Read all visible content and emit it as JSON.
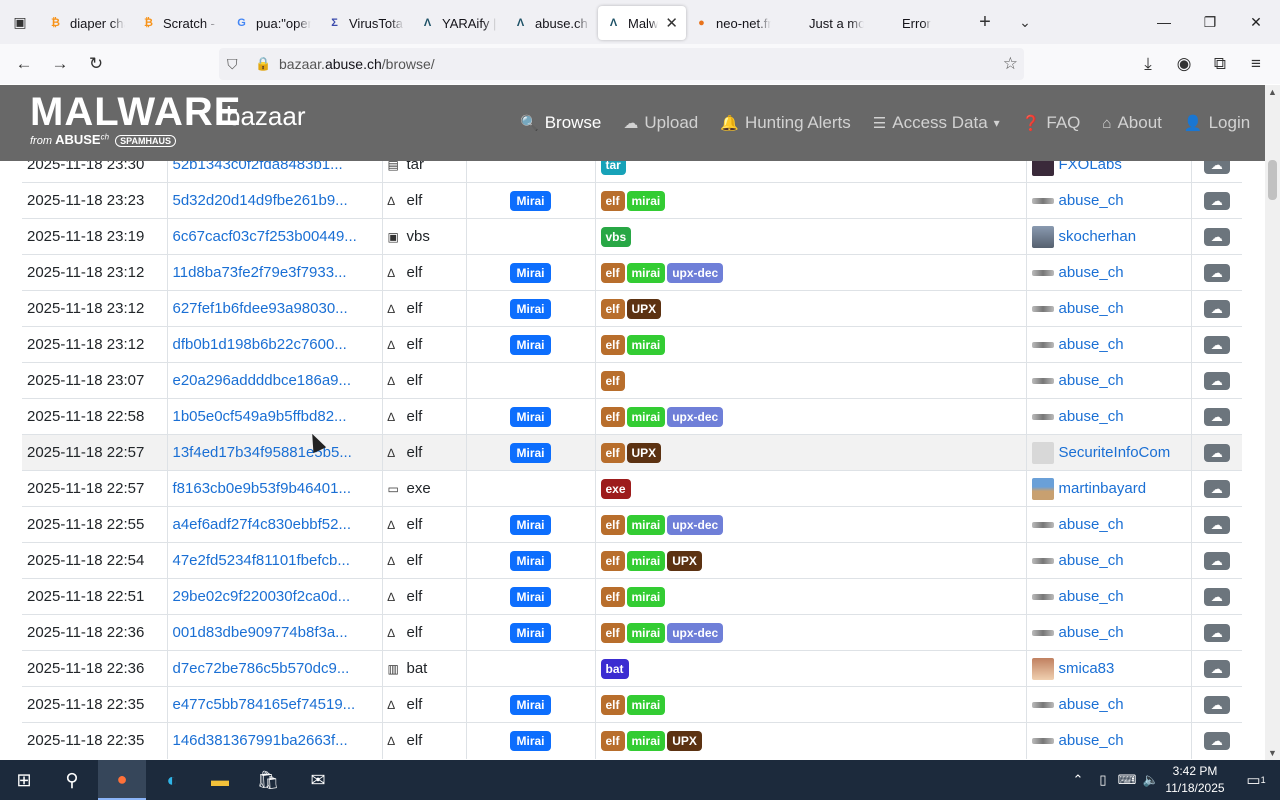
{
  "browser": {
    "tabs": [
      {
        "title": "diaper cha",
        "fav": "₿",
        "favcolor": "#f7931a"
      },
      {
        "title": "Scratch - I",
        "fav": "₿",
        "favcolor": "#f7931a"
      },
      {
        "title": "pua:\"open",
        "fav": "G",
        "favcolor": "#4285f4"
      },
      {
        "title": "VirusTotal",
        "fav": "Σ",
        "favcolor": "#3949ab"
      },
      {
        "title": "YARAify | C",
        "fav": "Λ",
        "favcolor": "#1d5166"
      },
      {
        "title": "abuse.ch |",
        "fav": "Λ",
        "favcolor": "#1d5166"
      },
      {
        "title": "Malwar",
        "fav": "Λ",
        "favcolor": "#1d5166",
        "active": true
      },
      {
        "title": "neo-net.fr",
        "fav": "●",
        "favcolor": "#e8731c"
      },
      {
        "title": "Just a moment",
        "fav": "",
        "favcolor": "transparent"
      },
      {
        "title": "Error",
        "fav": "",
        "favcolor": "transparent"
      }
    ],
    "url_prefix": "bazaar.",
    "url_domain": "abuse.ch",
    "url_path": "/browse/"
  },
  "site": {
    "logo_main": "MALWARE",
    "logo_sub": "bazaar",
    "logo_from": "from",
    "logo_abuse": "ABUSE",
    "logo_ch": "ch",
    "logo_spamhaus": "SPAMHAUS",
    "nav": [
      {
        "label": "Browse",
        "icon": "🔍",
        "active": true
      },
      {
        "label": "Upload",
        "icon": "☁"
      },
      {
        "label": "Hunting Alerts",
        "icon": "🔔"
      },
      {
        "label": "Access Data",
        "icon": "☰",
        "caret": "▾"
      },
      {
        "label": "FAQ",
        "icon": "❓"
      },
      {
        "label": "About",
        "icon": "⌂"
      },
      {
        "label": "Login",
        "icon": "👤"
      }
    ]
  },
  "colors": {
    "tag_elf": "#b86e2c",
    "tag_mirai": "#33cc33",
    "tag_upx_dec": "#6f7fd8",
    "tag_UPX": "#5c3212",
    "tag_vbs": "#28a745",
    "tag_exe": "#9d1c1c",
    "tag_bat": "#3b2cd1",
    "tag_tar": "#17a2b8",
    "signature": "#0d6efd",
    "link": "#1a6fd4"
  },
  "rows": [
    {
      "date": "2025-11-18 23:30",
      "hash": "52b1343c0f2fda8483b1...",
      "type": "tar",
      "type_icon": "▤",
      "signature": "",
      "tags": [
        "tar"
      ],
      "reporter": "FXOLabs",
      "avatar": "dark"
    },
    {
      "date": "2025-11-18 23:23",
      "hash": "5d32d20d14d9fbe261b9...",
      "type": "elf",
      "type_icon": "∆",
      "signature": "Mirai",
      "tags": [
        "elf",
        "mirai"
      ],
      "reporter": "abuse_ch",
      "avatar": "small"
    },
    {
      "date": "2025-11-18 23:19",
      "hash": "6c67cacf03c7f253b00449...",
      "type": "vbs",
      "type_icon": "▣",
      "signature": "",
      "tags": [
        "vbs"
      ],
      "reporter": "skocherhan",
      "avatar": "photo"
    },
    {
      "date": "2025-11-18 23:12",
      "hash": "11d8ba73fe2f79e3f7933...",
      "type": "elf",
      "type_icon": "∆",
      "signature": "Mirai",
      "tags": [
        "elf",
        "mirai",
        "upx-dec"
      ],
      "reporter": "abuse_ch",
      "avatar": "small"
    },
    {
      "date": "2025-11-18 23:12",
      "hash": "627fef1b6fdee93a98030...",
      "type": "elf",
      "type_icon": "∆",
      "signature": "Mirai",
      "tags": [
        "elf",
        "UPX"
      ],
      "reporter": "abuse_ch",
      "avatar": "small"
    },
    {
      "date": "2025-11-18 23:12",
      "hash": "dfb0b1d198b6b22c7600...",
      "type": "elf",
      "type_icon": "∆",
      "signature": "Mirai",
      "tags": [
        "elf",
        "mirai"
      ],
      "reporter": "abuse_ch",
      "avatar": "small"
    },
    {
      "date": "2025-11-18 23:07",
      "hash": "e20a296addddbce186a9...",
      "type": "elf",
      "type_icon": "∆",
      "signature": "",
      "tags": [
        "elf"
      ],
      "reporter": "abuse_ch",
      "avatar": "small"
    },
    {
      "date": "2025-11-18 22:58",
      "hash": "1b05e0cf549a9b5ffbd82...",
      "type": "elf",
      "type_icon": "∆",
      "signature": "Mirai",
      "tags": [
        "elf",
        "mirai",
        "upx-dec"
      ],
      "reporter": "abuse_ch",
      "avatar": "small"
    },
    {
      "date": "2025-11-18 22:57",
      "hash": "13f4ed17b34f95881e5b5...",
      "type": "elf",
      "type_icon": "∆",
      "signature": "Mirai",
      "tags": [
        "elf",
        "UPX"
      ],
      "reporter": "SecuriteInfoCom",
      "avatar": "grey",
      "hover": true
    },
    {
      "date": "2025-11-18 22:57",
      "hash": "f8163cb0e9b53f9b46401...",
      "type": "exe",
      "type_icon": "▭",
      "signature": "",
      "tags": [
        "exe"
      ],
      "reporter": "martinbayard",
      "avatar": "photo2"
    },
    {
      "date": "2025-11-18 22:55",
      "hash": "a4ef6adf27f4c830ebbf52...",
      "type": "elf",
      "type_icon": "∆",
      "signature": "Mirai",
      "tags": [
        "elf",
        "mirai",
        "upx-dec"
      ],
      "reporter": "abuse_ch",
      "avatar": "small"
    },
    {
      "date": "2025-11-18 22:54",
      "hash": "47e2fd5234f81101fbefcb...",
      "type": "elf",
      "type_icon": "∆",
      "signature": "Mirai",
      "tags": [
        "elf",
        "mirai",
        "UPX"
      ],
      "reporter": "abuse_ch",
      "avatar": "small"
    },
    {
      "date": "2025-11-18 22:51",
      "hash": "29be02c9f220030f2ca0d...",
      "type": "elf",
      "type_icon": "∆",
      "signature": "Mirai",
      "tags": [
        "elf",
        "mirai"
      ],
      "reporter": "abuse_ch",
      "avatar": "small"
    },
    {
      "date": "2025-11-18 22:36",
      "hash": "001d83dbe909774b8f3a...",
      "type": "elf",
      "type_icon": "∆",
      "signature": "Mirai",
      "tags": [
        "elf",
        "mirai",
        "upx-dec"
      ],
      "reporter": "abuse_ch",
      "avatar": "small"
    },
    {
      "date": "2025-11-18 22:36",
      "hash": "d7ec72be786c5b570dc9...",
      "type": "bat",
      "type_icon": "▥",
      "signature": "",
      "tags": [
        "bat"
      ],
      "reporter": "smica83",
      "avatar": "photo3"
    },
    {
      "date": "2025-11-18 22:35",
      "hash": "e477c5bb784165ef74519...",
      "type": "elf",
      "type_icon": "∆",
      "signature": "Mirai",
      "tags": [
        "elf",
        "mirai"
      ],
      "reporter": "abuse_ch",
      "avatar": "small"
    },
    {
      "date": "2025-11-18 22:35",
      "hash": "146d381367991ba2663f...",
      "type": "elf",
      "type_icon": "∆",
      "signature": "Mirai",
      "tags": [
        "elf",
        "mirai",
        "UPX"
      ],
      "reporter": "abuse_ch",
      "avatar": "small"
    }
  ],
  "download_icon": "☁",
  "taskbar": {
    "time": "3:42 PM",
    "date": "11/18/2025",
    "notif_count": "1"
  }
}
